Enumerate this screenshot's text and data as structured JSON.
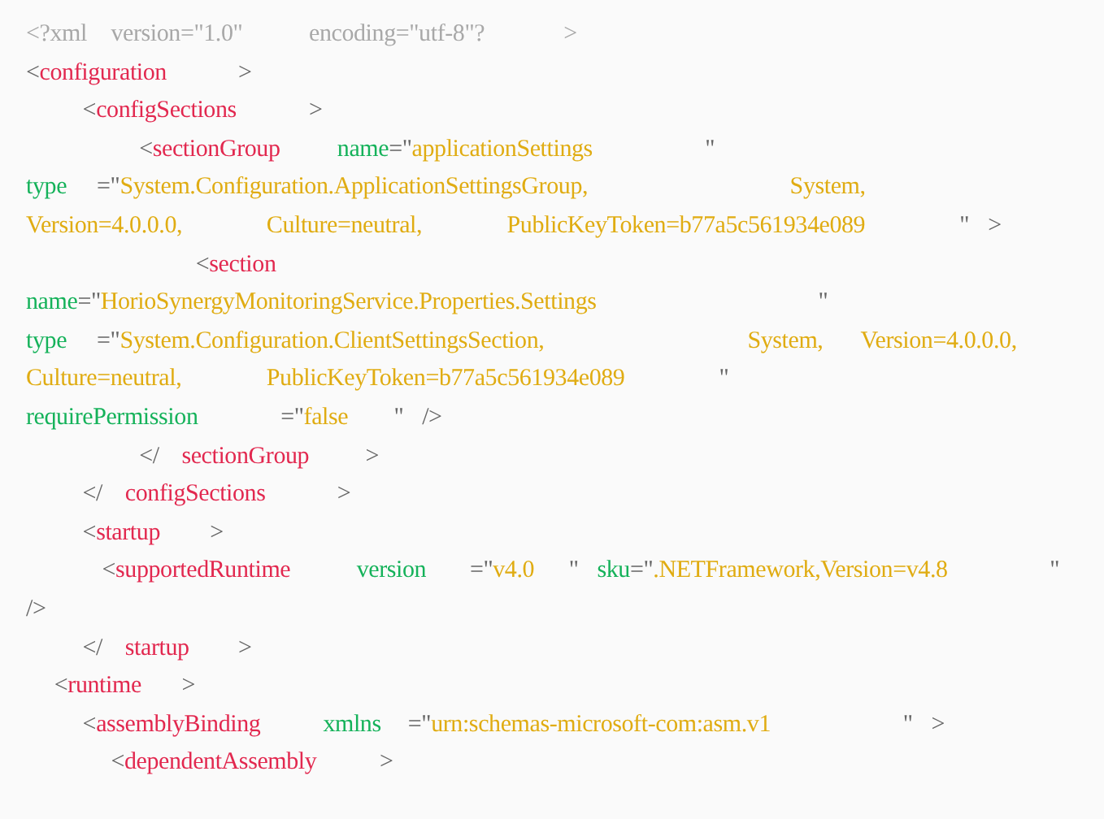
{
  "code_lines": [
    {
      "words": [
        [
          {
            "kind": "decl",
            "text": "<?xml"
          }
        ],
        [
          {
            "kind": "decl",
            "text": "version=\"1.0\""
          }
        ],
        [
          {
            "kind": "decl",
            "text": "encoding=\"utf-8\"?"
          }
        ],
        [
          {
            "kind": "decl",
            "text": ">"
          }
        ]
      ]
    },
    {
      "words": [
        [
          {
            "kind": "punct",
            "text": "<"
          },
          {
            "kind": "tag",
            "text": "configuration"
          }
        ],
        [
          {
            "kind": "punct",
            "text": ">"
          }
        ]
      ]
    },
    {
      "words": [
        [
          {
            "kind": "punct",
            "text": "    <"
          },
          {
            "kind": "tag",
            "text": "configSections"
          }
        ],
        [
          {
            "kind": "punct",
            "text": ">"
          }
        ]
      ]
    },
    {
      "words": [
        [
          {
            "kind": "punct",
            "text": "        <"
          },
          {
            "kind": "tag",
            "text": "sectionGroup"
          }
        ],
        [
          {
            "kind": "attr",
            "text": "name"
          },
          {
            "kind": "punct",
            "text": "=\""
          },
          {
            "kind": "value",
            "text": "applicationSettings"
          }
        ],
        [
          {
            "kind": "punct",
            "text": "\""
          }
        ]
      ]
    },
    {
      "words": [
        [
          {
            "kind": "attr",
            "text": "type"
          }
        ],
        [
          {
            "kind": "punct",
            "text": "=\""
          },
          {
            "kind": "value",
            "text": "System.Configuration.ApplicationSettingsGroup,"
          }
        ],
        [
          {
            "kind": "value",
            "text": "System,"
          }
        ]
      ]
    },
    {
      "words": [
        [
          {
            "kind": "value",
            "text": "Version=4.0.0.0,"
          }
        ],
        [
          {
            "kind": "value",
            "text": "Culture=neutral,"
          }
        ],
        [
          {
            "kind": "value",
            "text": "PublicKeyToken=b77a5c561934e089"
          }
        ],
        [
          {
            "kind": "punct",
            "text": "\""
          }
        ],
        [
          {
            "kind": "punct",
            "text": ">"
          }
        ]
      ]
    },
    {
      "words": [
        [
          {
            "kind": "punct",
            "text": "            <"
          },
          {
            "kind": "tag",
            "text": "section"
          }
        ]
      ]
    },
    {
      "words": [
        [
          {
            "kind": "attr",
            "text": "name"
          },
          {
            "kind": "punct",
            "text": "=\""
          },
          {
            "kind": "value",
            "text": "HorioSynergyMonitoringService.Properties.Settings"
          }
        ],
        [
          {
            "kind": "punct",
            "text": "\""
          }
        ]
      ]
    },
    {
      "words": [
        [
          {
            "kind": "attr",
            "text": "type"
          }
        ],
        [
          {
            "kind": "punct",
            "text": "=\""
          },
          {
            "kind": "value",
            "text": "System.Configuration.ClientSettingsSection,"
          }
        ],
        [
          {
            "kind": "value",
            "text": "System,"
          }
        ],
        [
          {
            "kind": "value",
            "text": "Version=4.0.0.0,"
          }
        ]
      ]
    },
    {
      "words": [
        [
          {
            "kind": "value",
            "text": "Culture=neutral,"
          }
        ],
        [
          {
            "kind": "value",
            "text": "PublicKeyToken=b77a5c561934e089"
          }
        ],
        [
          {
            "kind": "punct",
            "text": "\""
          }
        ]
      ]
    },
    {
      "words": [
        [
          {
            "kind": "attr",
            "text": "requirePermission"
          }
        ],
        [
          {
            "kind": "punct",
            "text": "=\""
          },
          {
            "kind": "value",
            "text": "false"
          }
        ],
        [
          {
            "kind": "punct",
            "text": "\""
          }
        ],
        [
          {
            "kind": "punct",
            "text": "/>"
          }
        ]
      ]
    },
    {
      "words": [
        [
          {
            "kind": "punct",
            "text": "        </"
          }
        ],
        [
          {
            "kind": "tag",
            "text": "sectionGroup"
          }
        ],
        [
          {
            "kind": "punct",
            "text": ">"
          }
        ]
      ]
    },
    {
      "words": [
        [
          {
            "kind": "punct",
            "text": "    </"
          }
        ],
        [
          {
            "kind": "tag",
            "text": "configSections"
          }
        ],
        [
          {
            "kind": "punct",
            "text": ">"
          }
        ]
      ]
    },
    {
      "words": [
        [
          {
            "kind": "punct",
            "text": "    <"
          },
          {
            "kind": "tag",
            "text": "startup"
          }
        ],
        [
          {
            "kind": "punct",
            "text": ">"
          }
        ]
      ]
    },
    {
      "words": [
        [
          {
            "kind": "punct",
            "text": "        <"
          },
          {
            "kind": "tag",
            "text": "supportedRuntime"
          }
        ],
        [
          {
            "kind": "attr",
            "text": "version"
          }
        ],
        [
          {
            "kind": "punct",
            "text": "=\""
          },
          {
            "kind": "value",
            "text": "v4.0"
          }
        ],
        [
          {
            "kind": "punct",
            "text": "\""
          }
        ],
        [
          {
            "kind": "attr",
            "text": "sku"
          },
          {
            "kind": "punct",
            "text": "=\""
          },
          {
            "kind": "value",
            "text": ".NETFramework,Version=v4.8"
          }
        ],
        [
          {
            "kind": "punct",
            "text": "\""
          }
        ]
      ]
    },
    {
      "words": [
        [
          {
            "kind": "punct",
            "text": "/>"
          }
        ]
      ]
    },
    {
      "words": [
        [
          {
            "kind": "punct",
            "text": "    </"
          }
        ],
        [
          {
            "kind": "tag",
            "text": "startup"
          }
        ],
        [
          {
            "kind": "punct",
            "text": ">"
          }
        ]
      ]
    },
    {
      "words": [
        [
          {
            "kind": "punct",
            "text": "  <"
          },
          {
            "kind": "tag",
            "text": "runtime"
          }
        ],
        [
          {
            "kind": "punct",
            "text": ">"
          }
        ]
      ]
    },
    {
      "words": [
        [
          {
            "kind": "punct",
            "text": "    <"
          },
          {
            "kind": "tag",
            "text": "assemblyBinding"
          }
        ],
        [
          {
            "kind": "attr",
            "text": "xmlns"
          }
        ],
        [
          {
            "kind": "punct",
            "text": "=\""
          },
          {
            "kind": "value",
            "text": "urn:schemas-microsoft-com:asm.v1"
          }
        ],
        [
          {
            "kind": "punct",
            "text": "\""
          }
        ],
        [
          {
            "kind": "punct",
            "text": ">"
          }
        ]
      ]
    },
    {
      "words": [
        [
          {
            "kind": "punct",
            "text": "      <"
          },
          {
            "kind": "tag",
            "text": "dependentAssembly"
          }
        ],
        [
          {
            "kind": "punct",
            "text": ">"
          }
        ]
      ]
    }
  ]
}
